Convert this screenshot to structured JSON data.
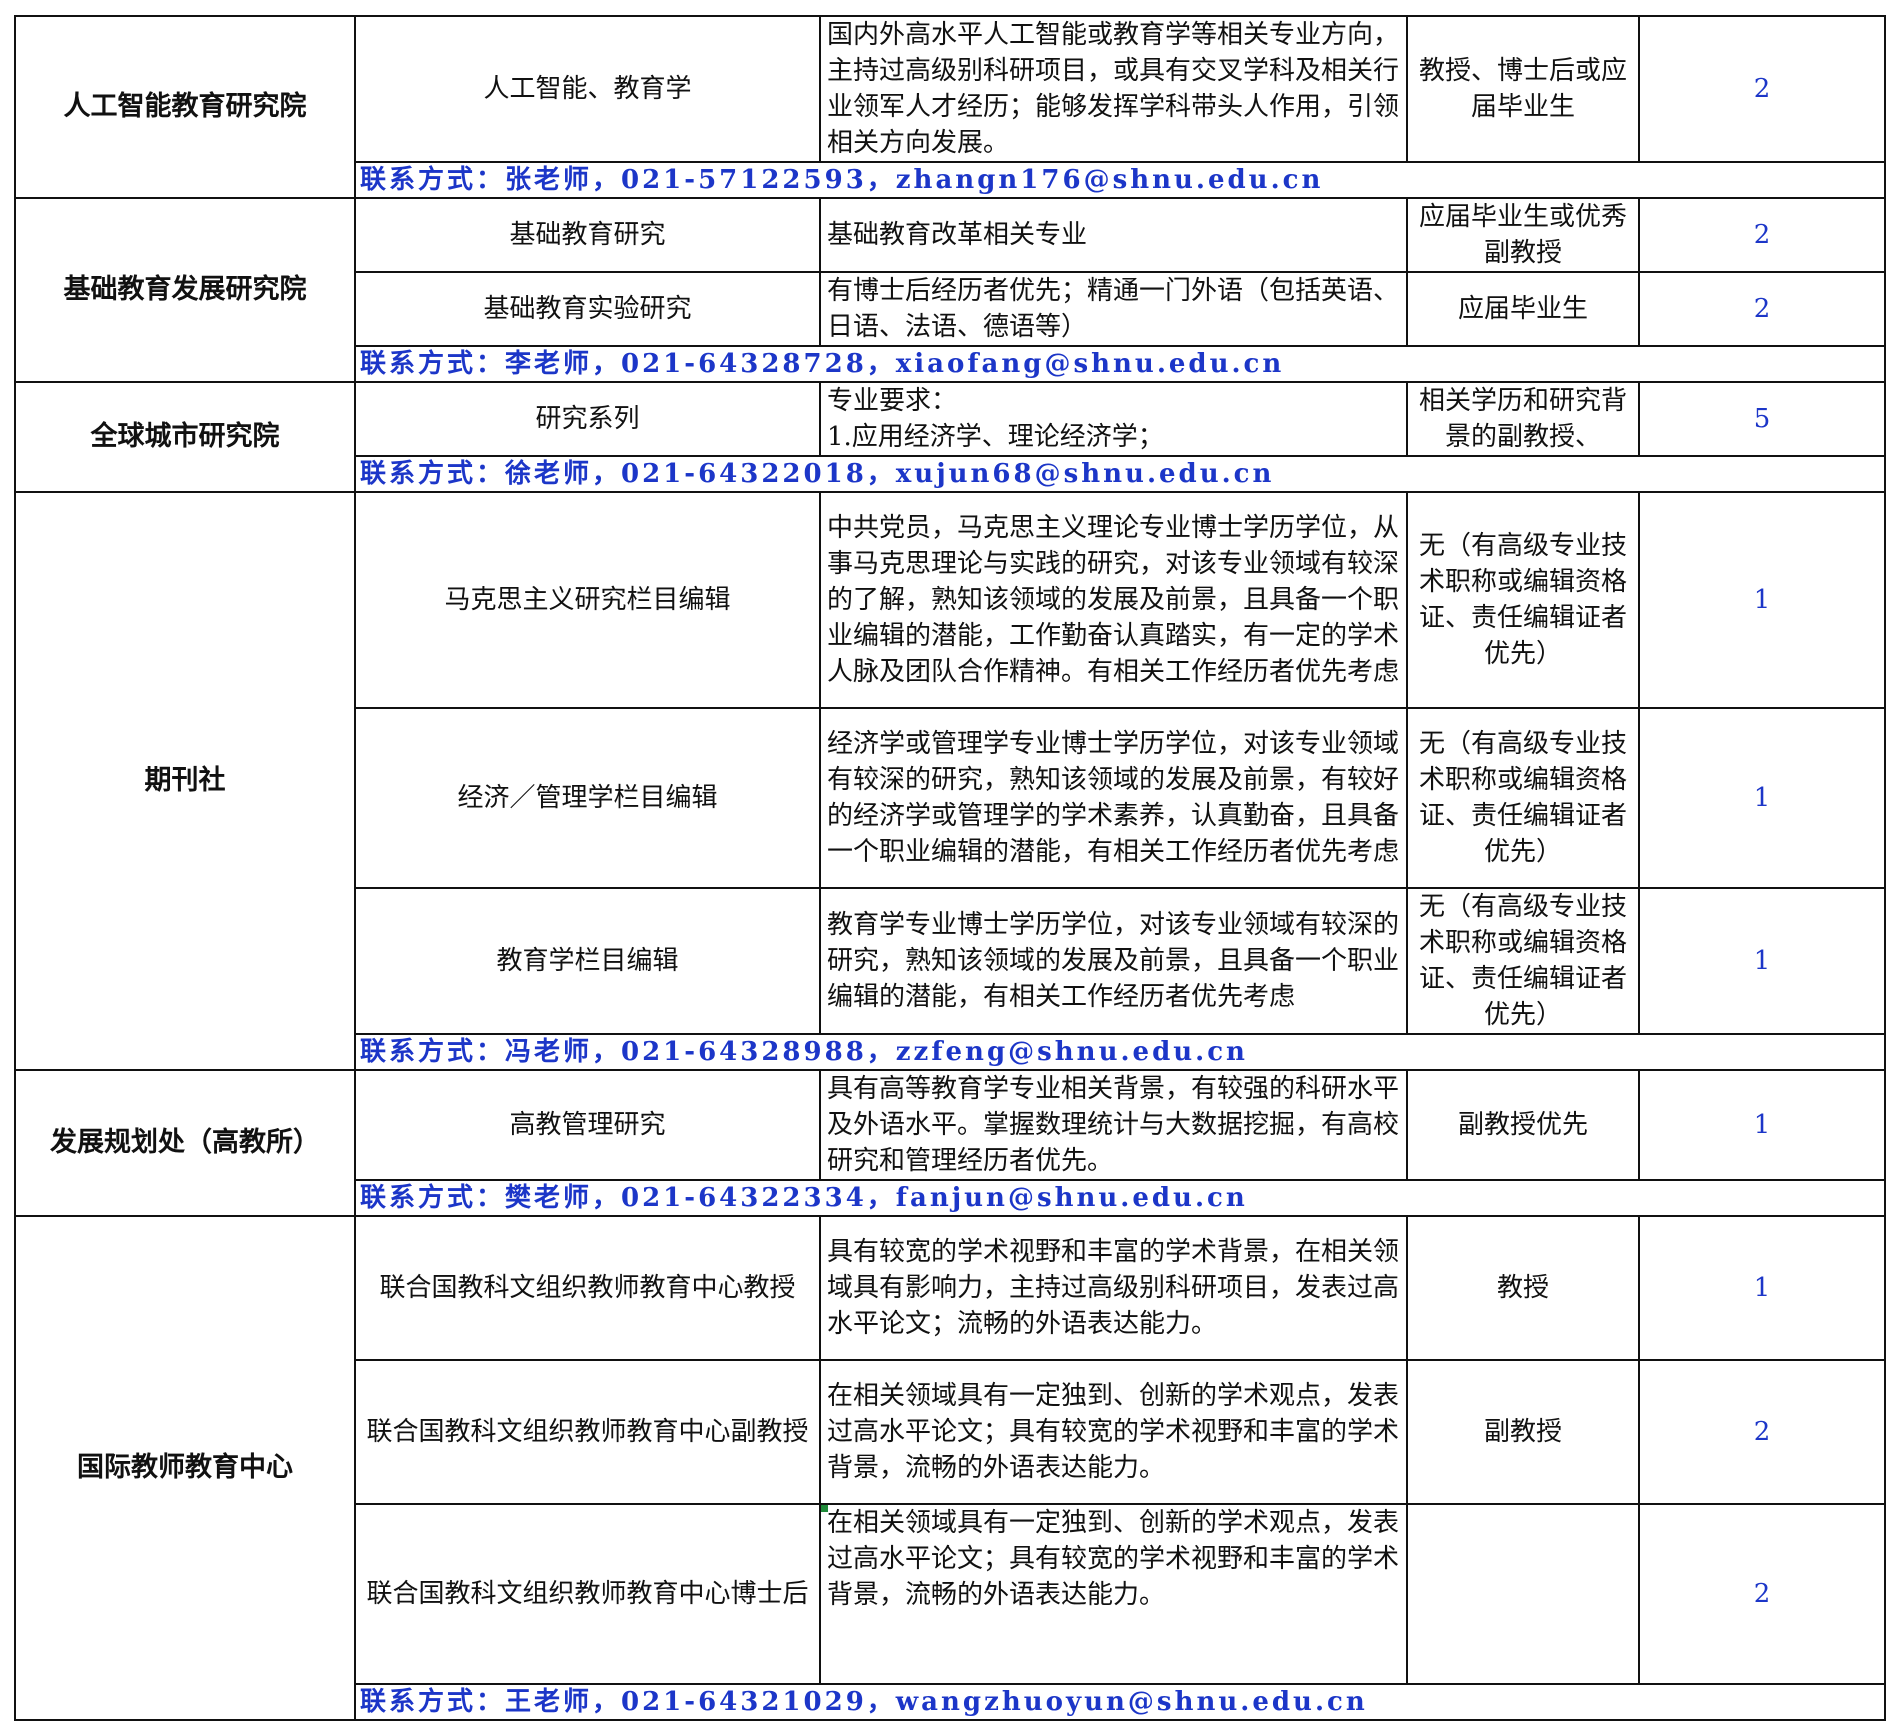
{
  "sections": [
    {
      "dept": "人工智能教育研究院",
      "rows": [
        {
          "position": "人工智能、教育学",
          "requirement": "国内外高水平人工智能或教育学等相关专业方向，主持过高级别科研项目，或具有交叉学科及相关行业领军人才经历；能够发挥学科带头人作用，引领相关方向发展。",
          "qualification": "教授、博士后或应届毕业生",
          "count": "2"
        }
      ],
      "contact": "联系方式：张老师，021-57122593，zhangn176@shnu.edu.cn"
    },
    {
      "dept": "基础教育发展研究院",
      "rows": [
        {
          "position": "基础教育研究",
          "requirement": "基础教育改革相关专业",
          "qualification": "应届毕业生或优秀副教授",
          "count": "2"
        },
        {
          "position": "基础教育实验研究",
          "requirement": "有博士后经历者优先；精通一门外语（包括英语、日语、法语、德语等）",
          "qualification": "应届毕业生",
          "count": "2"
        }
      ],
      "contact": "联系方式：李老师，021-64328728，xiaofang@shnu.edu.cn"
    },
    {
      "dept": "全球城市研究院",
      "rows": [
        {
          "position": "研究系列",
          "requirement": "专业要求：\n1.应用经济学、理论经济学；",
          "qualification": "相关学历和研究背景的副教授、",
          "count": "5"
        }
      ],
      "contact": "联系方式：徐老师，021-64322018，xujun68@shnu.edu.cn"
    },
    {
      "dept": "期刊社",
      "rows": [
        {
          "position": "马克思主义研究栏目编辑",
          "requirement": "中共党员，马克思主义理论专业博士学历学位，从事马克思理论与实践的研究，对该专业领域有较深的了解，熟知该领域的发展及前景，且具备一个职业编辑的潜能，工作勤奋认真踏实，有一定的学术人脉及团队合作精神。有相关工作经历者优先考虑",
          "qualification": "无（有高级专业技术职称或编辑资格证、责任编辑证者优先）",
          "count": "1"
        },
        {
          "position": "经济／管理学栏目编辑",
          "requirement": "经济学或管理学专业博士学历学位，对该专业领域有较深的研究，熟知该领域的发展及前景，有较好的经济学或管理学的学术素养，认真勤奋，且具备一个职业编辑的潜能，有相关工作经历者优先考虑",
          "qualification": "无（有高级专业技术职称或编辑资格证、责任编辑证者优先）",
          "count": "1"
        },
        {
          "position": "教育学栏目编辑",
          "requirement": "教育学专业博士学历学位，对该专业领域有较深的研究，熟知该领域的发展及前景，且具备一个职业编辑的潜能，有相关工作经历者优先考虑",
          "qualification": "无（有高级专业技术职称或编辑资格证、责任编辑证者优先）",
          "count": "1"
        }
      ],
      "contact": "联系方式：冯老师，021-64328988，zzfeng@shnu.edu.cn"
    },
    {
      "dept": "发展规划处（高教所）",
      "rows": [
        {
          "position": "高教管理研究",
          "requirement": "具有高等教育学专业相关背景，有较强的科研水平及外语水平。掌握数理统计与大数据挖掘，有高校研究和管理经历者优先。",
          "qualification": "副教授优先",
          "count": "1"
        }
      ],
      "contact": "联系方式：樊老师，021-64322334，fanjun@shnu.edu.cn"
    },
    {
      "dept": "国际教师教育中心",
      "rows": [
        {
          "position": "联合国教科文组织教师教育中心教授",
          "requirement": "具有较宽的学术视野和丰富的学术背景，在相关领域具有影响力，主持过高级别科研项目，发表过高水平论文；流畅的外语表达能力。",
          "qualification": "教授",
          "count": "1"
        },
        {
          "position": "联合国教科文组织教师教育中心副教授",
          "requirement": "在相关领域具有一定独到、创新的学术观点，发表过高水平论文；具有较宽的学术视野和丰富的学术背景，流畅的外语表达能力。",
          "qualification": "副教授",
          "count": "2"
        },
        {
          "position": "联合国教科文组织教师教育中心博士后",
          "requirement": "在相关领域具有一定独到、创新的学术观点，发表过高水平论文；具有较宽的学术视野和丰富的学术背景，流畅的外语表达能力。",
          "qualification": "",
          "count": "2"
        }
      ],
      "contact": "联系方式：王老师，021-64321029，wangzhuoyun@shnu.edu.cn"
    }
  ]
}
